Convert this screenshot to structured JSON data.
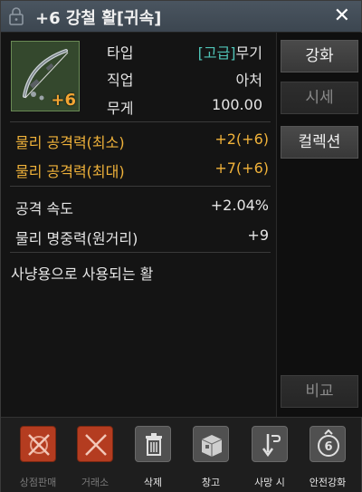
{
  "window": {
    "title": "+6 강철 활[귀속]",
    "close_symbol": "✕"
  },
  "item": {
    "enhance_badge": "+6",
    "type_label": "타입",
    "type_grade": "[고급]",
    "type_value": "무기",
    "class_label": "직업",
    "class_value": "아처",
    "weight_label": "무게",
    "weight_value": "100.00"
  },
  "stats_primary": [
    {
      "label": "물리 공격력(최소)",
      "value": "+2(+6)"
    },
    {
      "label": "물리 공격력(최대)",
      "value": "+7(+6)"
    }
  ],
  "stats_secondary": [
    {
      "label": "공격 속도",
      "value": "+2.04%"
    },
    {
      "label": "물리 명중력(원거리)",
      "value": "+9"
    }
  ],
  "description": "사냥용으로 사용되는 활",
  "side_buttons": {
    "enhance": "강화",
    "market": "시세",
    "collection": "컬렉션",
    "compare": "비교"
  },
  "bottom_actions": [
    {
      "label": "상점판매",
      "icon": "no-sell-icon",
      "enabled": false
    },
    {
      "label": "거래소",
      "icon": "no-trade-icon",
      "enabled": false
    },
    {
      "label": "삭제",
      "icon": "trash-icon",
      "enabled": true
    },
    {
      "label": "창고",
      "icon": "storage-box-icon",
      "enabled": true
    },
    {
      "label": "사망 시",
      "icon": "death-drop-icon",
      "enabled": true
    },
    {
      "label": "안전강화",
      "icon": "safe-enhance-icon",
      "enabled": true
    }
  ],
  "safe_enhance_level": "6",
  "colors": {
    "grade": "#4fc3b6",
    "highlight_stat": "#f0b23a",
    "enhance_badge": "#f3a533",
    "disabled_action": "#b43c20"
  }
}
